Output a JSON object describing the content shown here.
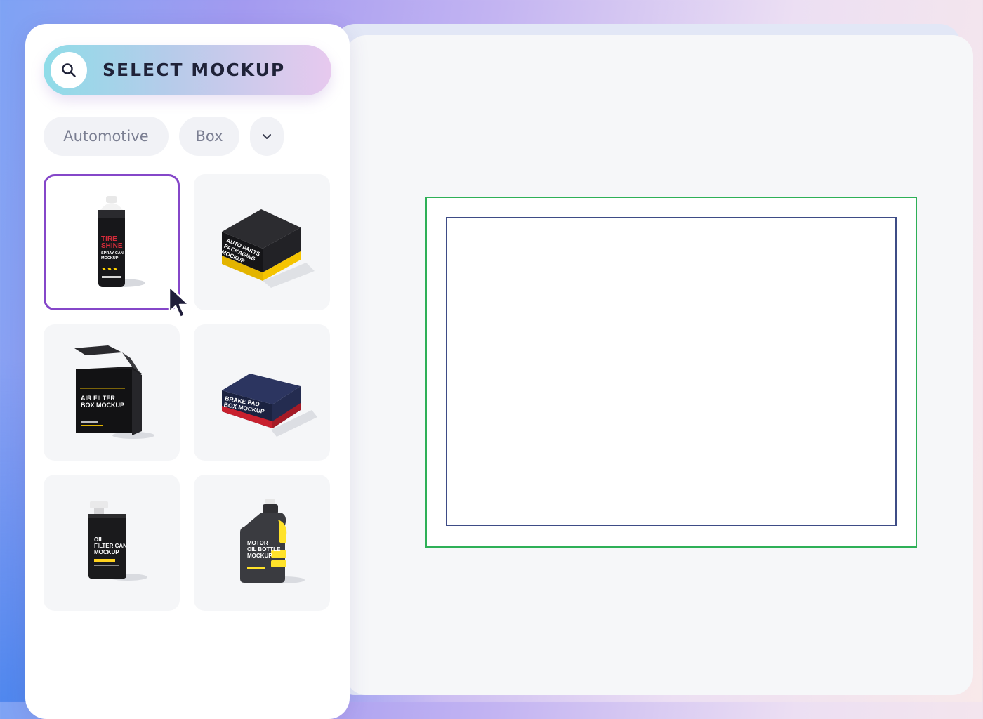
{
  "search": {
    "label": "SELECT MOCKUP",
    "icon": "search-icon"
  },
  "filters": [
    {
      "label": "Automotive"
    },
    {
      "label": "Box"
    }
  ],
  "more_filters_icon": "chevron-down-icon",
  "mockups": [
    {
      "name": "tire-shine-spray-can",
      "lines": [
        "TIRE",
        "SHINE",
        "SPRAY CAN",
        "MOCKUP"
      ],
      "selected": true
    },
    {
      "name": "auto-parts-packaging-box",
      "lines": [
        "AUTO PARTS",
        "PACKAGING",
        "MOCKUP"
      ],
      "selected": false
    },
    {
      "name": "air-filter-box",
      "lines": [
        "AIR FILTER",
        "BOX MOCKUP"
      ],
      "selected": false
    },
    {
      "name": "brake-pad-box",
      "lines": [
        "BRAKE PAD",
        "BOX MOCKUP"
      ],
      "selected": false
    },
    {
      "name": "oil-filter-can",
      "lines": [
        "OIL",
        "FILTER CAN",
        "MOCKUP"
      ],
      "selected": false
    },
    {
      "name": "motor-oil-bottle",
      "lines": [
        "MOTOR",
        "OIL BOTTLE",
        "MOCKUP"
      ],
      "selected": false
    }
  ],
  "colors": {
    "selected_border": "#8547c9",
    "outer_frame": "#2eb057",
    "inner_frame": "#3e4c86"
  }
}
